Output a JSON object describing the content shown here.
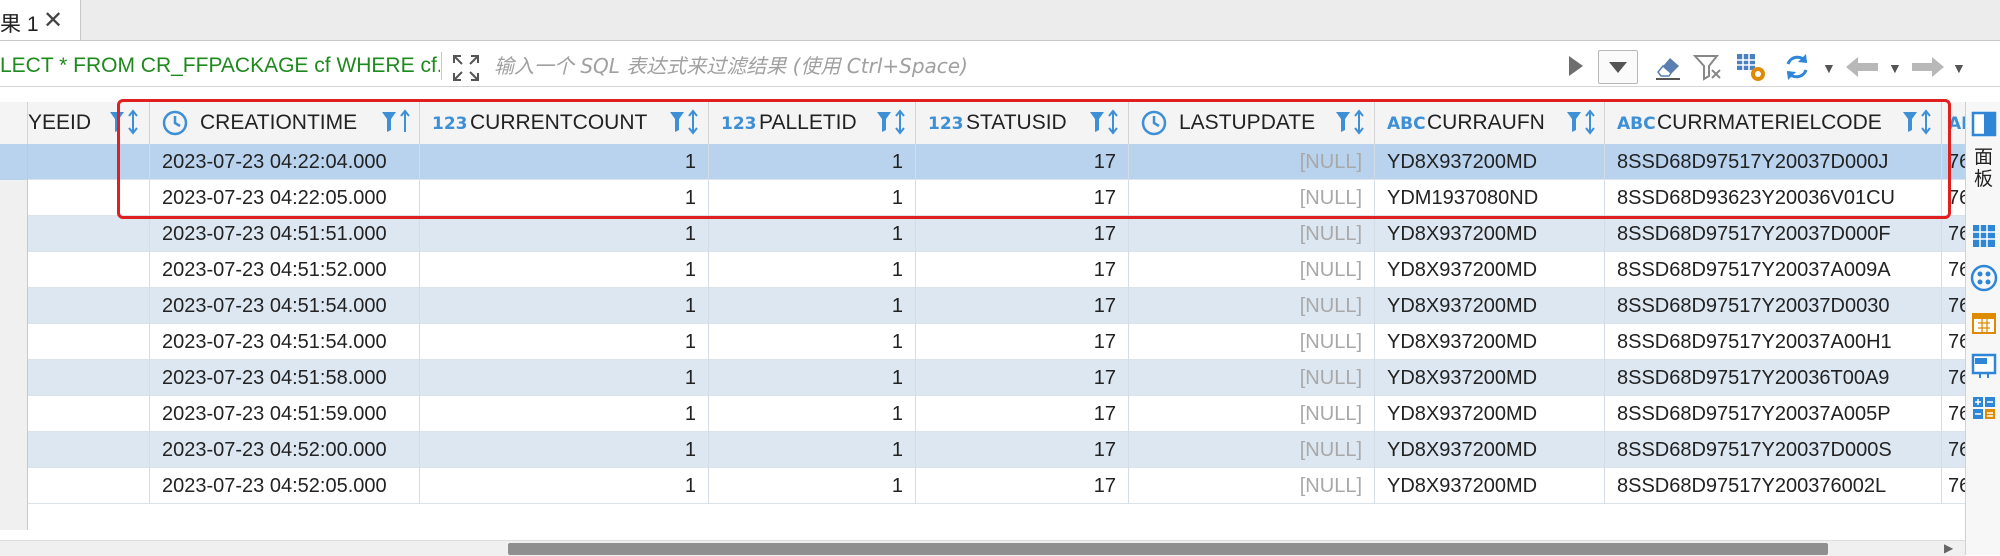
{
  "tab": {
    "label": "果 1",
    "close_glyph": "✕"
  },
  "toolbar": {
    "sql": "LECT * FROM CR_FFPACKAGE cf WHERE cf.(",
    "filter_placeholder": "输入一个 SQL 表达式来过滤结果 (使用 Ctrl+Space)"
  },
  "columns": [
    {
      "name": "YEEID",
      "type": ""
    },
    {
      "name": "CREATIONTIME",
      "type": "clock"
    },
    {
      "name": "CURRENTCOUNT",
      "type": "123"
    },
    {
      "name": "PALLETID",
      "type": "123"
    },
    {
      "name": "STATUSID",
      "type": "123"
    },
    {
      "name": "LASTUPDATE",
      "type": "clock"
    },
    {
      "name": "CURRAUFN",
      "type": "ABC"
    },
    {
      "name": "CURRMATERIELCODE",
      "type": "ABC"
    },
    {
      "name": "",
      "type": "AB"
    }
  ],
  "rows": [
    {
      "creationtime": "2023-07-23 04:22:04.000",
      "currentcount": "1",
      "palletid": "1",
      "statusid": "17",
      "lastupdate": "[NULL]",
      "currraufn": "YD8X937200MD",
      "currmaterielcode": "8SSD68D97517Y20037D000J",
      "next": "76"
    },
    {
      "creationtime": "2023-07-23 04:22:05.000",
      "currentcount": "1",
      "palletid": "1",
      "statusid": "17",
      "lastupdate": "[NULL]",
      "currraufn": "YDM1937080ND",
      "currmaterielcode": "8SSD68D93623Y20036V01CU",
      "next": "76"
    },
    {
      "creationtime": "2023-07-23 04:51:51.000",
      "currentcount": "1",
      "palletid": "1",
      "statusid": "17",
      "lastupdate": "[NULL]",
      "currraufn": "YD8X937200MD",
      "currmaterielcode": "8SSD68D97517Y20037D000F",
      "next": "76"
    },
    {
      "creationtime": "2023-07-23 04:51:52.000",
      "currentcount": "1",
      "palletid": "1",
      "statusid": "17",
      "lastupdate": "[NULL]",
      "currraufn": "YD8X937200MD",
      "currmaterielcode": "8SSD68D97517Y20037A009A",
      "next": "76"
    },
    {
      "creationtime": "2023-07-23 04:51:54.000",
      "currentcount": "1",
      "palletid": "1",
      "statusid": "17",
      "lastupdate": "[NULL]",
      "currraufn": "YD8X937200MD",
      "currmaterielcode": "8SSD68D97517Y20037D0030",
      "next": "76"
    },
    {
      "creationtime": "2023-07-23 04:51:54.000",
      "currentcount": "1",
      "palletid": "1",
      "statusid": "17",
      "lastupdate": "[NULL]",
      "currraufn": "YD8X937200MD",
      "currmaterielcode": "8SSD68D97517Y20037A00H1",
      "next": "76"
    },
    {
      "creationtime": "2023-07-23 04:51:58.000",
      "currentcount": "1",
      "palletid": "1",
      "statusid": "17",
      "lastupdate": "[NULL]",
      "currraufn": "YD8X937200MD",
      "currmaterielcode": "8SSD68D97517Y20036T00A9",
      "next": "76"
    },
    {
      "creationtime": "2023-07-23 04:51:59.000",
      "currentcount": "1",
      "palletid": "1",
      "statusid": "17",
      "lastupdate": "[NULL]",
      "currraufn": "YD8X937200MD",
      "currmaterielcode": "8SSD68D97517Y20037A005P",
      "next": "76"
    },
    {
      "creationtime": "2023-07-23 04:52:00.000",
      "currentcount": "1",
      "palletid": "1",
      "statusid": "17",
      "lastupdate": "[NULL]",
      "currraufn": "YD8X937200MD",
      "currmaterielcode": "8SSD68D97517Y20037D000S",
      "next": "76"
    },
    {
      "creationtime": "2023-07-23 04:52:05.000",
      "currentcount": "1",
      "palletid": "1",
      "statusid": "17",
      "lastupdate": "[NULL]",
      "currraufn": "YD8X937200MD",
      "currmaterielcode": "8SSD68D97517Y200376002L",
      "next": "76"
    }
  ],
  "side_panel": {
    "label": "面板"
  },
  "colors": {
    "highlight": "#e02020",
    "selected_row": "#b9d3ee",
    "alt_row": "#dde7f2",
    "type_badge": "#3d8fd6",
    "sql_text": "#1e8a1e"
  },
  "icons": [
    "close-icon",
    "expand-icon",
    "run-icon",
    "history-dropdown-icon",
    "erase-filter-icon",
    "funnel-clear-icon",
    "settings-icon",
    "refresh-icon",
    "back-arrow-icon",
    "forward-arrow-icon",
    "clock-icon",
    "filter-sort-icon",
    "panel-icon",
    "grid-icon",
    "dots-icon",
    "calendar-icon",
    "layout-icon",
    "calculator-icon"
  ]
}
